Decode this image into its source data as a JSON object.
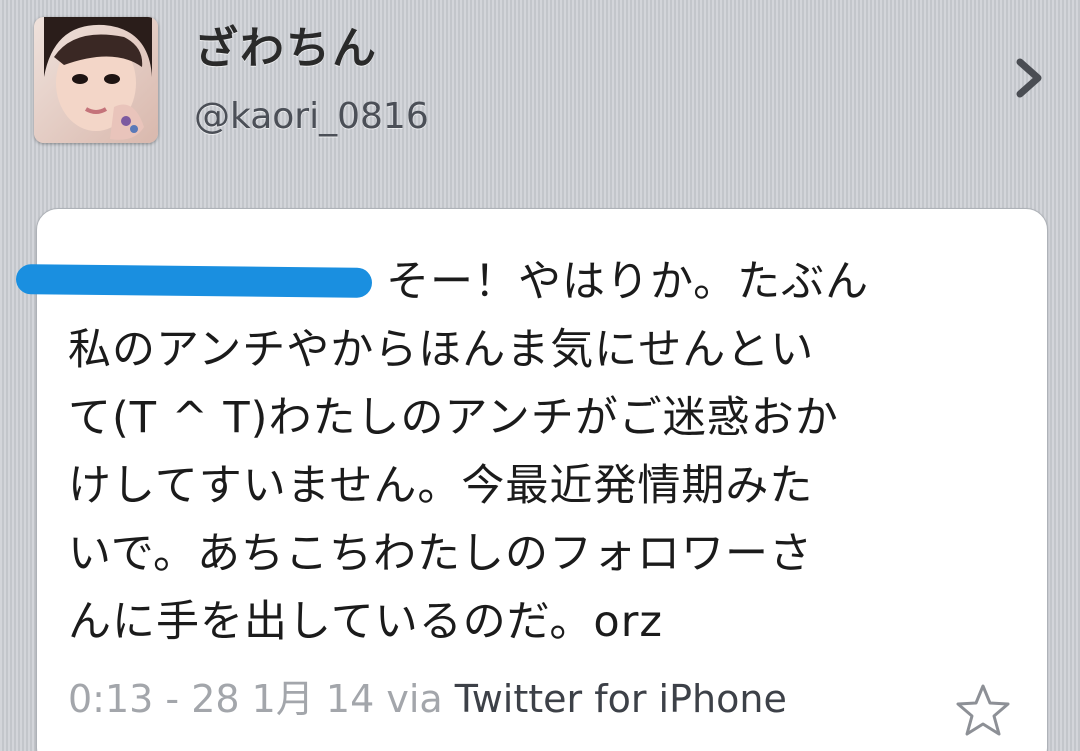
{
  "profile": {
    "display_name": "ざわちん",
    "handle": "@kaori_0816",
    "avatar_icon": "user-avatar-photo",
    "chevron_icon": "chevron-right-icon"
  },
  "tweet": {
    "lines": [
      "そー！やはりか。たぶん",
      "私のアンチやからほんま気にせんとい",
      "て(T ^ T)わたしのアンチがご迷惑おか",
      "けしてすいません。今最近発情期みた",
      "いで。あちこちわたしのフォロワーさ",
      "んに手を出しているのだ。orz"
    ],
    "timestamp": "0:13 - 28 1月 14",
    "via_label": "via",
    "client": "Twitter for iPhone",
    "favorite_icon": "star-outline-icon"
  },
  "colors": {
    "background": "#c9ccd2",
    "card": "#ffffff",
    "redaction_mark": "#1a8fe0",
    "meta_text": "#a3a6ab"
  }
}
